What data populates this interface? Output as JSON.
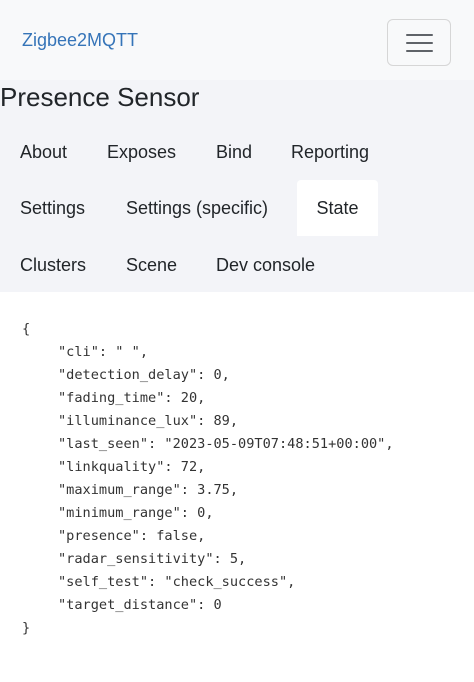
{
  "navbar": {
    "brand": "Zigbee2MQTT",
    "menu_icon": "hamburger-menu-icon"
  },
  "page": {
    "title": "Presence Sensor"
  },
  "tabs": [
    {
      "label": "About",
      "active": false
    },
    {
      "label": "Exposes",
      "active": false
    },
    {
      "label": "Bind",
      "active": false
    },
    {
      "label": "Reporting",
      "active": false
    },
    {
      "label": "Settings",
      "active": false
    },
    {
      "label": "Settings (specific)",
      "active": false
    },
    {
      "label": "State",
      "active": true
    },
    {
      "label": "Clusters",
      "active": false
    },
    {
      "label": "Scene",
      "active": false
    },
    {
      "label": "Dev console",
      "active": false
    }
  ],
  "state_json": {
    "open_brace": "{",
    "close_brace": "}",
    "lines": [
      "\"cli\": \" \",",
      "\"detection_delay\": 0,",
      "\"fading_time\": 20,",
      "\"illuminance_lux\": 89,",
      "\"last_seen\": \"2023-05-09T07:48:51+00:00\",",
      "\"linkquality\": 72,",
      "\"maximum_range\": 3.75,",
      "\"minimum_range\": 0,",
      "\"presence\": false,",
      "\"radar_sensitivity\": 5,",
      "\"self_test\": \"check_success\",",
      "\"target_distance\": 0"
    ]
  },
  "colors": {
    "brand": "#3574b8",
    "navbar_bg": "#f8f9fa",
    "tabs_bg": "#f3f4f8",
    "active_tab_bg": "#ffffff"
  }
}
